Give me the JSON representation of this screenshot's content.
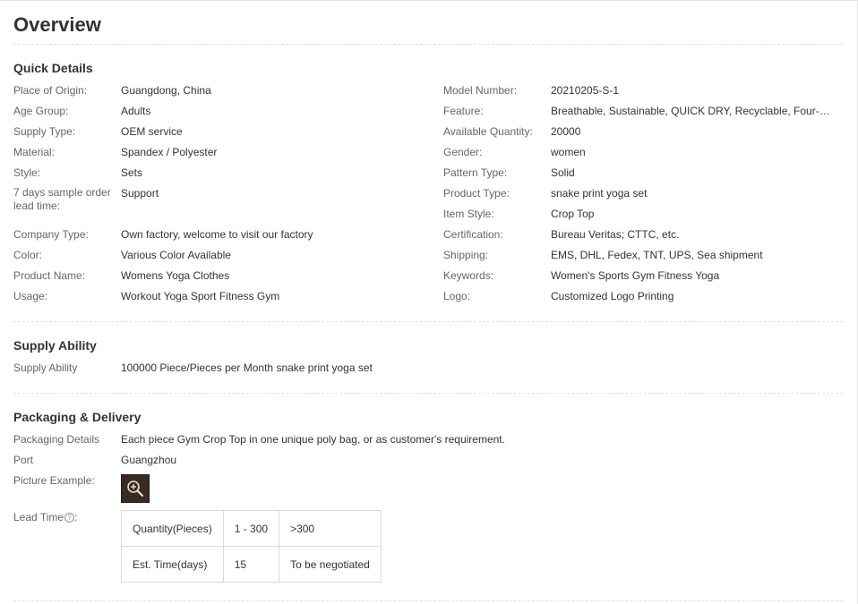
{
  "title": "Overview",
  "quick_details": {
    "heading": "Quick Details",
    "left": [
      {
        "label": "Place of Origin:",
        "value": "Guangdong, China"
      },
      {
        "label": "Age Group:",
        "value": "Adults"
      },
      {
        "label": "Supply Type:",
        "value": "OEM service"
      },
      {
        "label": "Material:",
        "value": "Spandex / Polyester"
      },
      {
        "label": "Style:",
        "value": "Sets"
      },
      {
        "label": "7 days sample order lead time:",
        "value": "Support"
      },
      {
        "label": "Company Type:",
        "value": "Own factory, welcome to visit our factory"
      },
      {
        "label": "Color:",
        "value": "Various Color Available"
      },
      {
        "label": "Product Name:",
        "value": "Womens Yoga Clothes"
      },
      {
        "label": "Usage:",
        "value": "Workout Yoga Sport Fitness Gym"
      }
    ],
    "right": [
      {
        "label": "Model Number:",
        "value": "20210205-S-1"
      },
      {
        "label": "Feature:",
        "value": "Breathable, Sustainable, QUICK DRY, Recyclable, Four-Way St..."
      },
      {
        "label": "Available Quantity:",
        "value": "20000"
      },
      {
        "label": "Gender:",
        "value": "women"
      },
      {
        "label": "Pattern Type:",
        "value": "Solid"
      },
      {
        "label": "Product Type:",
        "value": "snake print yoga set"
      },
      {
        "label": "Item Style:",
        "value": "Crop Top"
      },
      {
        "label": "Certification:",
        "value": "Bureau Veritas; CTTC, etc."
      },
      {
        "label": "Shipping:",
        "value": "EMS, DHL, Fedex, TNT, UPS, Sea shipment"
      },
      {
        "label": "Keywords:",
        "value": "Women's Sports Gym Fitness Yoga"
      },
      {
        "label": "Logo:",
        "value": "Customized Logo Printing"
      }
    ]
  },
  "supply_ability": {
    "heading": "Supply Ability",
    "label": "Supply Ability",
    "value": "100000 Piece/Pieces per Month snake print yoga set"
  },
  "packaging": {
    "heading": "Packaging & Delivery",
    "details_label": "Packaging Details",
    "details_value": "Each piece Gym Crop Top in one unique poly bag, or as customer's requirement.",
    "port_label": "Port",
    "port_value": "Guangzhou",
    "picture_label": "Picture Example:",
    "lead_time_label": "Lead Time",
    "help_glyph": "?",
    "lead_table": {
      "row1": [
        "Quantity(Pieces)",
        "1 - 300",
        ">300"
      ],
      "row2": [
        "Est. Time(days)",
        "15",
        "To be negotiated"
      ]
    }
  },
  "colors": {
    "label": "#666666",
    "value": "#333333",
    "separator": "#e0e0e0"
  }
}
